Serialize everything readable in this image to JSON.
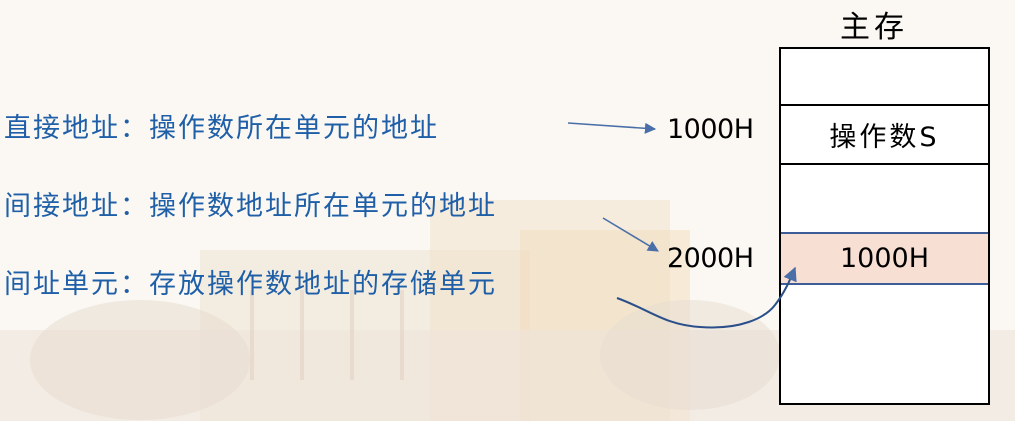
{
  "memory_title": "主存",
  "definitions": [
    "直接地址：操作数所在单元的地址",
    "间接地址：操作数地址所在单元的地址",
    "间址单元：存放操作数地址的存储单元"
  ],
  "addresses": {
    "operand_addr": "1000H",
    "pointer_addr": "2000H"
  },
  "cells": {
    "operand": "操作数S",
    "pointer": "1000H"
  },
  "colors": {
    "definition_text": "#1f5fa8",
    "pointer_cell_fill": "#f8dfd3",
    "arrow": "#4a6fa8"
  }
}
